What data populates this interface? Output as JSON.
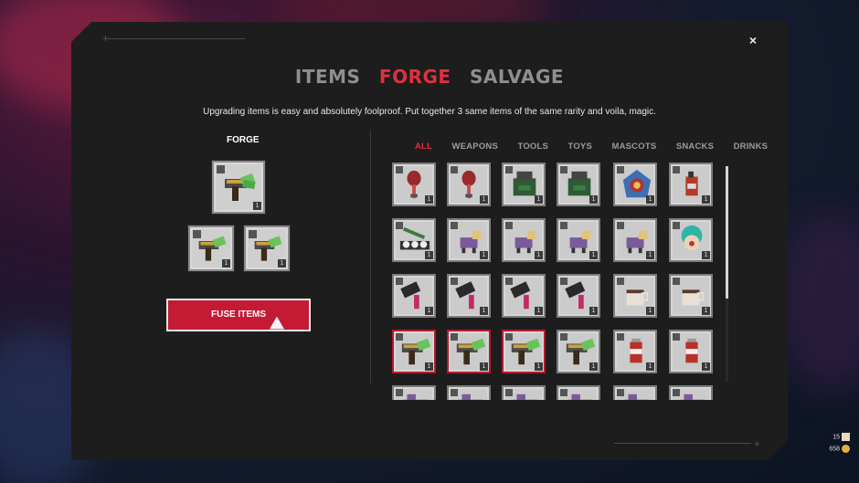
{
  "tabs": [
    {
      "label": "ITEMS",
      "active": false
    },
    {
      "label": "FORGE",
      "active": true
    },
    {
      "label": "SALVAGE",
      "active": false
    }
  ],
  "subtitle": "Upgrading items is easy and absolutely foolproof. Put together 3 same items of the same rarity and voila, magic.",
  "close_label": "×",
  "forge": {
    "title": "FORGE",
    "result_count": "1",
    "input_counts": [
      "1",
      "1"
    ],
    "fuse_label": "FUSE ITEMS"
  },
  "categories": [
    {
      "label": "ALL",
      "active": true
    },
    {
      "label": "WEAPONS",
      "active": false
    },
    {
      "label": "TOOLS",
      "active": false
    },
    {
      "label": "TOYS",
      "active": false
    },
    {
      "label": "MASCOTS",
      "active": false
    },
    {
      "label": "SNACKS",
      "active": false
    },
    {
      "label": "DRINKS",
      "active": false
    }
  ],
  "grid_items": [
    {
      "icon": "maraca-icon",
      "count": "1",
      "selected": false
    },
    {
      "icon": "maraca-icon",
      "count": "1",
      "selected": false
    },
    {
      "icon": "green-box-icon",
      "count": "1",
      "selected": false
    },
    {
      "icon": "green-box-icon",
      "count": "1",
      "selected": false
    },
    {
      "icon": "piranha-plant-icon",
      "count": "1",
      "selected": false
    },
    {
      "icon": "spray-can-icon",
      "count": "1",
      "selected": false
    },
    {
      "icon": "sushi-tray-icon",
      "count": "1",
      "selected": false
    },
    {
      "icon": "toy-dog-icon",
      "count": "1",
      "selected": false
    },
    {
      "icon": "toy-dog-icon",
      "count": "1",
      "selected": false
    },
    {
      "icon": "toy-dog-icon",
      "count": "1",
      "selected": false
    },
    {
      "icon": "toy-dog-icon",
      "count": "1",
      "selected": false
    },
    {
      "icon": "clown-icon",
      "count": "1",
      "selected": false
    },
    {
      "icon": "hammer-icon",
      "count": "1",
      "selected": false
    },
    {
      "icon": "hammer-icon",
      "count": "1",
      "selected": false
    },
    {
      "icon": "hammer-icon",
      "count": "1",
      "selected": false
    },
    {
      "icon": "hammer-icon",
      "count": "1",
      "selected": false
    },
    {
      "icon": "coffee-mug-icon",
      "count": "1",
      "selected": false
    },
    {
      "icon": "coffee-mug-icon",
      "count": "1",
      "selected": false
    },
    {
      "icon": "money-gun-icon",
      "count": "1",
      "selected": true
    },
    {
      "icon": "money-gun-icon",
      "count": "1",
      "selected": true
    },
    {
      "icon": "money-gun-icon",
      "count": "1",
      "selected": true
    },
    {
      "icon": "money-gun-icon",
      "count": "1",
      "selected": false
    },
    {
      "icon": "soda-can-icon",
      "count": "1",
      "selected": false
    },
    {
      "icon": "soda-can-icon",
      "count": "1",
      "selected": false
    },
    {
      "icon": "partial-item-icon",
      "count": "",
      "selected": false
    },
    {
      "icon": "partial-item-icon",
      "count": "",
      "selected": false
    },
    {
      "icon": "partial-item-icon",
      "count": "",
      "selected": false
    },
    {
      "icon": "partial-item-icon",
      "count": "",
      "selected": false
    },
    {
      "icon": "partial-item-icon",
      "count": "",
      "selected": false
    },
    {
      "icon": "partial-item-icon",
      "count": "",
      "selected": false
    }
  ],
  "hud": {
    "heads": "15",
    "coins": "658"
  },
  "colors": {
    "accent": "#e0303f",
    "button": "#c41a34",
    "panel": "#1d1d1d"
  }
}
